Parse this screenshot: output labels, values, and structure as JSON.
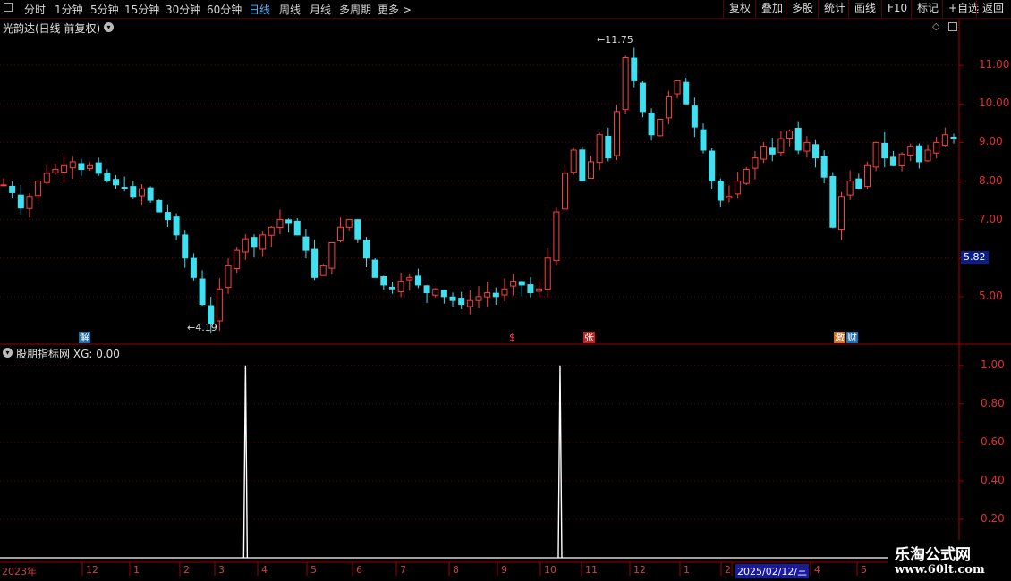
{
  "toolbar": {
    "periods": [
      "分时",
      "1分钟",
      "5分钟",
      "15分钟",
      "30分钟",
      "60分钟",
      "日线",
      "周线",
      "月线",
      "多周期",
      "更多 >"
    ],
    "active_period": "日线",
    "right_buttons": [
      "复权",
      "叠加",
      "多股",
      "统计",
      "画线",
      "F10",
      "标记",
      "+自选",
      "返回"
    ]
  },
  "main_panel": {
    "title": "光韵达(日线 前复权)",
    "high_label": "11.75",
    "low_label": "4.19",
    "current_price_tag": "5.82",
    "y_axis": [
      "11.00",
      "10.00",
      "9.00",
      "8.00",
      "7.00",
      "5.00"
    ],
    "event_tags": [
      {
        "text": "解",
        "color": "#1a6fb0"
      },
      {
        "text": "$",
        "color": "#c02020"
      },
      {
        "text": "张",
        "color": "#c02020"
      },
      {
        "text": "激",
        "color": "#d07020"
      },
      {
        "text": "财",
        "color": "#1a6fb0"
      }
    ]
  },
  "indicator_panel": {
    "title": "股朋指标网",
    "value_text": "XG: 0.00",
    "y_axis": [
      "1.00",
      "0.80",
      "0.60",
      "0.40",
      "0.20"
    ]
  },
  "date_axis": {
    "labels": [
      "2023年",
      "12",
      "1",
      "2",
      "3",
      "4",
      "5",
      "6",
      "7",
      "8",
      "9",
      "10",
      "11",
      "12",
      "1",
      "2",
      "2025/02/12/三",
      "4",
      "5"
    ],
    "highlight": "2025/02/12/三"
  },
  "watermark": {
    "line1": "乐淘公式网",
    "line2": "www.60lt.com"
  },
  "colors": {
    "up": "#ff4040",
    "down": "#40e0f0",
    "grid": "#6a0000",
    "axis_text": "#e03030",
    "accent_blue": "#4fb3ff"
  },
  "chart_data": {
    "type": "candlestick",
    "y_range": [
      4.0,
      12.0
    ],
    "close_series": [
      7.9,
      7.7,
      7.3,
      7.6,
      8.0,
      8.2,
      8.3,
      8.4,
      8.5,
      8.3,
      8.4,
      8.2,
      8.0,
      7.9,
      7.8,
      7.6,
      7.8,
      7.5,
      7.2,
      7.0,
      6.6,
      6.0,
      5.5,
      4.8,
      4.3,
      5.2,
      5.8,
      6.2,
      6.5,
      6.3,
      6.6,
      6.8,
      7.0,
      6.9,
      6.6,
      6.2,
      5.5,
      5.8,
      6.4,
      6.8,
      7.0,
      6.5,
      6.0,
      5.5,
      5.3,
      5.2,
      5.4,
      5.5,
      5.3,
      5.1,
      5.2,
      5.0,
      4.9,
      4.8,
      4.9,
      5.0,
      5.1,
      5.0,
      5.2,
      5.4,
      5.3,
      5.1,
      5.2,
      6.0,
      7.2,
      8.2,
      8.8,
      8.0,
      8.5,
      9.2,
      8.6,
      9.8,
      11.2,
      10.6,
      9.8,
      9.2,
      9.6,
      10.2,
      10.6,
      10.0,
      9.4,
      8.8,
      8.0,
      7.5,
      7.6,
      8.0,
      8.3,
      8.6,
      8.9,
      8.7,
      9.1,
      9.3,
      8.8,
      9.0,
      8.6,
      8.1,
      6.8,
      7.6,
      8.0,
      7.8,
      8.4,
      9.0,
      8.6,
      8.4,
      8.7,
      8.9,
      8.5,
      8.8,
      9.0,
      9.2,
      9.1
    ],
    "series": [
      {
        "name": "XG",
        "signals_at_fraction": [
          0.255,
          0.583
        ],
        "values": [
          1.0,
          1.0
        ]
      }
    ],
    "indicator_y_range": [
      0.0,
      1.05
    ]
  }
}
